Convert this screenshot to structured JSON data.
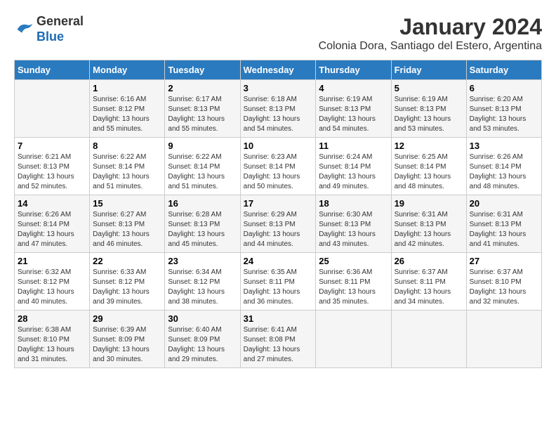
{
  "logo": {
    "general": "General",
    "blue": "Blue"
  },
  "title": "January 2024",
  "subtitle": "Colonia Dora, Santiago del Estero, Argentina",
  "days_of_week": [
    "Sunday",
    "Monday",
    "Tuesday",
    "Wednesday",
    "Thursday",
    "Friday",
    "Saturday"
  ],
  "weeks": [
    [
      {
        "day": "",
        "sunrise": "",
        "sunset": "",
        "daylight": ""
      },
      {
        "day": "1",
        "sunrise": "Sunrise: 6:16 AM",
        "sunset": "Sunset: 8:12 PM",
        "daylight": "Daylight: 13 hours and 55 minutes."
      },
      {
        "day": "2",
        "sunrise": "Sunrise: 6:17 AM",
        "sunset": "Sunset: 8:13 PM",
        "daylight": "Daylight: 13 hours and 55 minutes."
      },
      {
        "day": "3",
        "sunrise": "Sunrise: 6:18 AM",
        "sunset": "Sunset: 8:13 PM",
        "daylight": "Daylight: 13 hours and 54 minutes."
      },
      {
        "day": "4",
        "sunrise": "Sunrise: 6:19 AM",
        "sunset": "Sunset: 8:13 PM",
        "daylight": "Daylight: 13 hours and 54 minutes."
      },
      {
        "day": "5",
        "sunrise": "Sunrise: 6:19 AM",
        "sunset": "Sunset: 8:13 PM",
        "daylight": "Daylight: 13 hours and 53 minutes."
      },
      {
        "day": "6",
        "sunrise": "Sunrise: 6:20 AM",
        "sunset": "Sunset: 8:13 PM",
        "daylight": "Daylight: 13 hours and 53 minutes."
      }
    ],
    [
      {
        "day": "7",
        "sunrise": "Sunrise: 6:21 AM",
        "sunset": "Sunset: 8:13 PM",
        "daylight": "Daylight: 13 hours and 52 minutes."
      },
      {
        "day": "8",
        "sunrise": "Sunrise: 6:22 AM",
        "sunset": "Sunset: 8:14 PM",
        "daylight": "Daylight: 13 hours and 51 minutes."
      },
      {
        "day": "9",
        "sunrise": "Sunrise: 6:22 AM",
        "sunset": "Sunset: 8:14 PM",
        "daylight": "Daylight: 13 hours and 51 minutes."
      },
      {
        "day": "10",
        "sunrise": "Sunrise: 6:23 AM",
        "sunset": "Sunset: 8:14 PM",
        "daylight": "Daylight: 13 hours and 50 minutes."
      },
      {
        "day": "11",
        "sunrise": "Sunrise: 6:24 AM",
        "sunset": "Sunset: 8:14 PM",
        "daylight": "Daylight: 13 hours and 49 minutes."
      },
      {
        "day": "12",
        "sunrise": "Sunrise: 6:25 AM",
        "sunset": "Sunset: 8:14 PM",
        "daylight": "Daylight: 13 hours and 48 minutes."
      },
      {
        "day": "13",
        "sunrise": "Sunrise: 6:26 AM",
        "sunset": "Sunset: 8:14 PM",
        "daylight": "Daylight: 13 hours and 48 minutes."
      }
    ],
    [
      {
        "day": "14",
        "sunrise": "Sunrise: 6:26 AM",
        "sunset": "Sunset: 8:14 PM",
        "daylight": "Daylight: 13 hours and 47 minutes."
      },
      {
        "day": "15",
        "sunrise": "Sunrise: 6:27 AM",
        "sunset": "Sunset: 8:13 PM",
        "daylight": "Daylight: 13 hours and 46 minutes."
      },
      {
        "day": "16",
        "sunrise": "Sunrise: 6:28 AM",
        "sunset": "Sunset: 8:13 PM",
        "daylight": "Daylight: 13 hours and 45 minutes."
      },
      {
        "day": "17",
        "sunrise": "Sunrise: 6:29 AM",
        "sunset": "Sunset: 8:13 PM",
        "daylight": "Daylight: 13 hours and 44 minutes."
      },
      {
        "day": "18",
        "sunrise": "Sunrise: 6:30 AM",
        "sunset": "Sunset: 8:13 PM",
        "daylight": "Daylight: 13 hours and 43 minutes."
      },
      {
        "day": "19",
        "sunrise": "Sunrise: 6:31 AM",
        "sunset": "Sunset: 8:13 PM",
        "daylight": "Daylight: 13 hours and 42 minutes."
      },
      {
        "day": "20",
        "sunrise": "Sunrise: 6:31 AM",
        "sunset": "Sunset: 8:13 PM",
        "daylight": "Daylight: 13 hours and 41 minutes."
      }
    ],
    [
      {
        "day": "21",
        "sunrise": "Sunrise: 6:32 AM",
        "sunset": "Sunset: 8:12 PM",
        "daylight": "Daylight: 13 hours and 40 minutes."
      },
      {
        "day": "22",
        "sunrise": "Sunrise: 6:33 AM",
        "sunset": "Sunset: 8:12 PM",
        "daylight": "Daylight: 13 hours and 39 minutes."
      },
      {
        "day": "23",
        "sunrise": "Sunrise: 6:34 AM",
        "sunset": "Sunset: 8:12 PM",
        "daylight": "Daylight: 13 hours and 38 minutes."
      },
      {
        "day": "24",
        "sunrise": "Sunrise: 6:35 AM",
        "sunset": "Sunset: 8:11 PM",
        "daylight": "Daylight: 13 hours and 36 minutes."
      },
      {
        "day": "25",
        "sunrise": "Sunrise: 6:36 AM",
        "sunset": "Sunset: 8:11 PM",
        "daylight": "Daylight: 13 hours and 35 minutes."
      },
      {
        "day": "26",
        "sunrise": "Sunrise: 6:37 AM",
        "sunset": "Sunset: 8:11 PM",
        "daylight": "Daylight: 13 hours and 34 minutes."
      },
      {
        "day": "27",
        "sunrise": "Sunrise: 6:37 AM",
        "sunset": "Sunset: 8:10 PM",
        "daylight": "Daylight: 13 hours and 32 minutes."
      }
    ],
    [
      {
        "day": "28",
        "sunrise": "Sunrise: 6:38 AM",
        "sunset": "Sunset: 8:10 PM",
        "daylight": "Daylight: 13 hours and 31 minutes."
      },
      {
        "day": "29",
        "sunrise": "Sunrise: 6:39 AM",
        "sunset": "Sunset: 8:09 PM",
        "daylight": "Daylight: 13 hours and 30 minutes."
      },
      {
        "day": "30",
        "sunrise": "Sunrise: 6:40 AM",
        "sunset": "Sunset: 8:09 PM",
        "daylight": "Daylight: 13 hours and 29 minutes."
      },
      {
        "day": "31",
        "sunrise": "Sunrise: 6:41 AM",
        "sunset": "Sunset: 8:08 PM",
        "daylight": "Daylight: 13 hours and 27 minutes."
      },
      {
        "day": "",
        "sunrise": "",
        "sunset": "",
        "daylight": ""
      },
      {
        "day": "",
        "sunrise": "",
        "sunset": "",
        "daylight": ""
      },
      {
        "day": "",
        "sunrise": "",
        "sunset": "",
        "daylight": ""
      }
    ]
  ]
}
